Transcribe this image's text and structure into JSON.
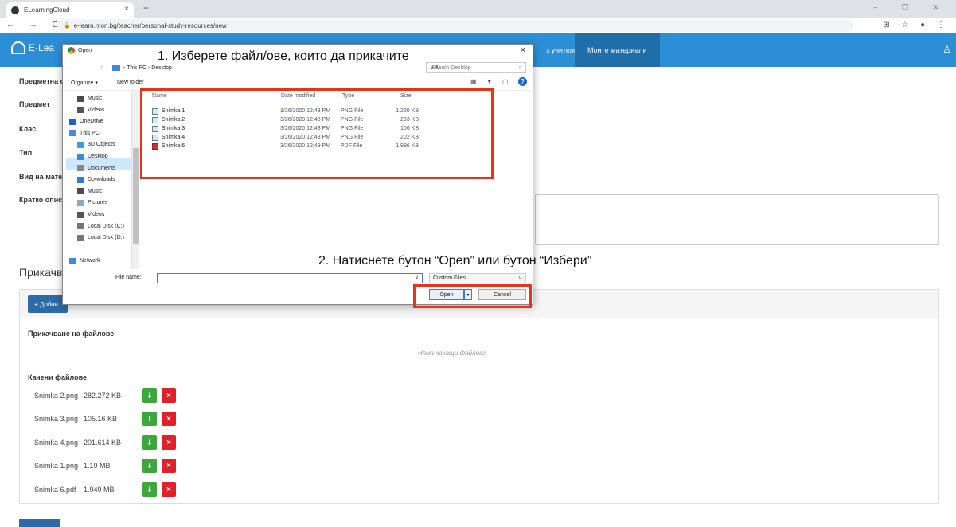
{
  "browser": {
    "tab_title": "ELearningCloud",
    "tab_close": "×",
    "new_tab": "+",
    "url": "e-learn.mon.bg/teacher/personal-study-resources/new",
    "nav_arrows": "← → C",
    "right_icons": "⊞ ☆ ● ⋮",
    "window_controls": "– ❐ ✕"
  },
  "site": {
    "logo": "E-Lea",
    "nav_teachers": "з учители",
    "nav_mine": "Моите материали",
    "user_icon": "♙"
  },
  "form": {
    "labels": [
      "Предметна о",
      "Предмет",
      "Клас",
      "Тип",
      "Вид на матер",
      "Кратко описа"
    ],
    "attach_title": "Прикачв",
    "add_button": "+ Добав",
    "upload_title": "Прикачване на файлове",
    "no_files": "Няма чакащи файлове",
    "uploaded_title": "Качени файлове",
    "files": [
      {
        "name": "Snimka 2.png",
        "size": "282.272 KB"
      },
      {
        "name": "Snimka 3.png",
        "size": "105.16 KB"
      },
      {
        "name": "Snimka 4.png",
        "size": "201.614 KB"
      },
      {
        "name": "Snimka 1.png",
        "size": "1.19 MB"
      },
      {
        "name": "Snimka 6.pdf",
        "size": "1.949 MB"
      }
    ],
    "download_glyph": "⬇",
    "delete_glyph": "×"
  },
  "dialog": {
    "title": "Open",
    "close": "✕",
    "nav_arrows": "← → ↑",
    "path": "› This PC › Desktop",
    "path_controls": "∨ ↻",
    "search_placeholder": "Search Desktop",
    "search_glyph": "⌕",
    "organize": "Organize ▾",
    "new_folder": "New folder",
    "view_icons": "▦ ▾ ▢",
    "help": "?",
    "nav_items": [
      {
        "label": "Music",
        "indent": 1
      },
      {
        "label": "Videos",
        "indent": 1
      },
      {
        "label": "OneDrive",
        "indent": 0
      },
      {
        "label": "This PC",
        "indent": 0
      },
      {
        "label": "3D Objects",
        "indent": 1
      },
      {
        "label": "Desktop",
        "indent": 1
      },
      {
        "label": "Documents",
        "indent": 1
      },
      {
        "label": "Downloads",
        "indent": 1
      },
      {
        "label": "Music",
        "indent": 1
      },
      {
        "label": "Pictures",
        "indent": 1
      },
      {
        "label": "Videos",
        "indent": 1
      },
      {
        "label": "Local Disk (C:)",
        "indent": 1
      },
      {
        "label": "Local Disk (D:)",
        "indent": 1
      },
      {
        "label": "",
        "indent": 0
      },
      {
        "label": "Network",
        "indent": 0
      }
    ],
    "columns": {
      "name": "Name",
      "date": "Date modified",
      "type": "Type",
      "size": "Size"
    },
    "files": [
      {
        "name": "Snimka 1",
        "date": "3/26/2020 12:43 PM",
        "type": "PNG File",
        "size": "1,220 KB",
        "pdf": false
      },
      {
        "name": "Snimka 2",
        "date": "3/26/2020 12:43 PM",
        "type": "PNG File",
        "size": "283 KB",
        "pdf": false
      },
      {
        "name": "Snimka 3",
        "date": "3/26/2020 12:43 PM",
        "type": "PNG File",
        "size": "106 KB",
        "pdf": false
      },
      {
        "name": "Snimka 4",
        "date": "3/26/2020 12:43 PM",
        "type": "PNG File",
        "size": "202 KB",
        "pdf": false
      },
      {
        "name": "Snimka 6",
        "date": "3/26/2020 12:49 PM",
        "type": "PDF File",
        "size": "1,996 KB",
        "pdf": true
      }
    ],
    "file_name_label": "File name:",
    "file_name_value": "",
    "file_name_drop": "∨",
    "filter": "Custom Files",
    "filter_drop": "∨",
    "open": "Open",
    "open_drop": "▾",
    "cancel": "Cancel"
  },
  "annotations": {
    "step1": "1. Изберете файл/ове, които да прикачите",
    "step2": "2. Натиснете бутон “Open” или бутон “Избери”",
    "color": "#e8321c"
  }
}
